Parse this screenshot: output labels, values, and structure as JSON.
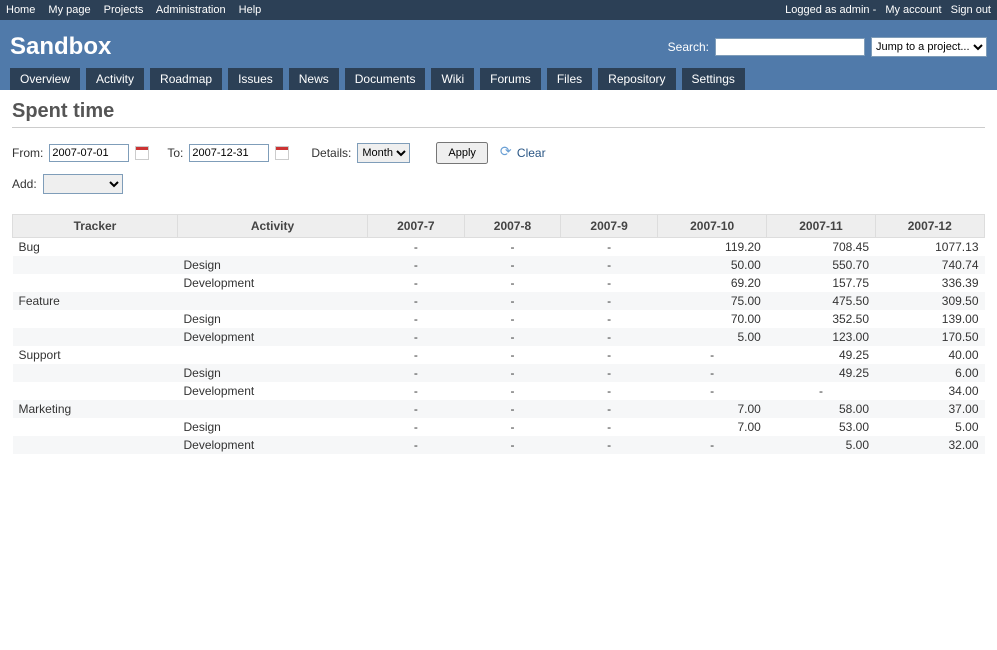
{
  "topnav": {
    "left": [
      "Home",
      "My page",
      "Projects",
      "Administration",
      "Help"
    ],
    "logged": "Logged as admin",
    "right": [
      "My account",
      "Sign out"
    ]
  },
  "header": {
    "title": "Sandbox",
    "search_label": "Search:",
    "jump_placeholder": "Jump to a project..."
  },
  "tabs": [
    "Overview",
    "Activity",
    "Roadmap",
    "Issues",
    "News",
    "Documents",
    "Wiki",
    "Forums",
    "Files",
    "Repository",
    "Settings"
  ],
  "page": {
    "title": "Spent time",
    "from_label": "From:",
    "from_value": "2007-07-01",
    "to_label": "To:",
    "to_value": "2007-12-31",
    "details_label": "Details:",
    "details_value": "Month",
    "apply_label": "Apply",
    "clear_label": "Clear",
    "add_label": "Add:"
  },
  "table": {
    "headers": [
      "Tracker",
      "Activity",
      "2007-7",
      "2007-8",
      "2007-9",
      "2007-10",
      "2007-11",
      "2007-12"
    ],
    "rows": [
      {
        "tracker": "Bug",
        "activity": "",
        "v": [
          "-",
          "-",
          "-",
          "119.20",
          "708.45",
          "1077.13"
        ]
      },
      {
        "tracker": "",
        "activity": "Design",
        "v": [
          "-",
          "-",
          "-",
          "50.00",
          "550.70",
          "740.74"
        ]
      },
      {
        "tracker": "",
        "activity": "Development",
        "v": [
          "-",
          "-",
          "-",
          "69.20",
          "157.75",
          "336.39"
        ]
      },
      {
        "tracker": "Feature",
        "activity": "",
        "v": [
          "-",
          "-",
          "-",
          "75.00",
          "475.50",
          "309.50"
        ]
      },
      {
        "tracker": "",
        "activity": "Design",
        "v": [
          "-",
          "-",
          "-",
          "70.00",
          "352.50",
          "139.00"
        ]
      },
      {
        "tracker": "",
        "activity": "Development",
        "v": [
          "-",
          "-",
          "-",
          "5.00",
          "123.00",
          "170.50"
        ]
      },
      {
        "tracker": "Support",
        "activity": "",
        "v": [
          "-",
          "-",
          "-",
          "-",
          "49.25",
          "40.00"
        ]
      },
      {
        "tracker": "",
        "activity": "Design",
        "v": [
          "-",
          "-",
          "-",
          "-",
          "49.25",
          "6.00"
        ]
      },
      {
        "tracker": "",
        "activity": "Development",
        "v": [
          "-",
          "-",
          "-",
          "-",
          "-",
          "34.00"
        ]
      },
      {
        "tracker": "Marketing",
        "activity": "",
        "v": [
          "-",
          "-",
          "-",
          "7.00",
          "58.00",
          "37.00"
        ]
      },
      {
        "tracker": "",
        "activity": "Design",
        "v": [
          "-",
          "-",
          "-",
          "7.00",
          "53.00",
          "5.00"
        ]
      },
      {
        "tracker": "",
        "activity": "Development",
        "v": [
          "-",
          "-",
          "-",
          "-",
          "5.00",
          "32.00"
        ]
      }
    ]
  }
}
